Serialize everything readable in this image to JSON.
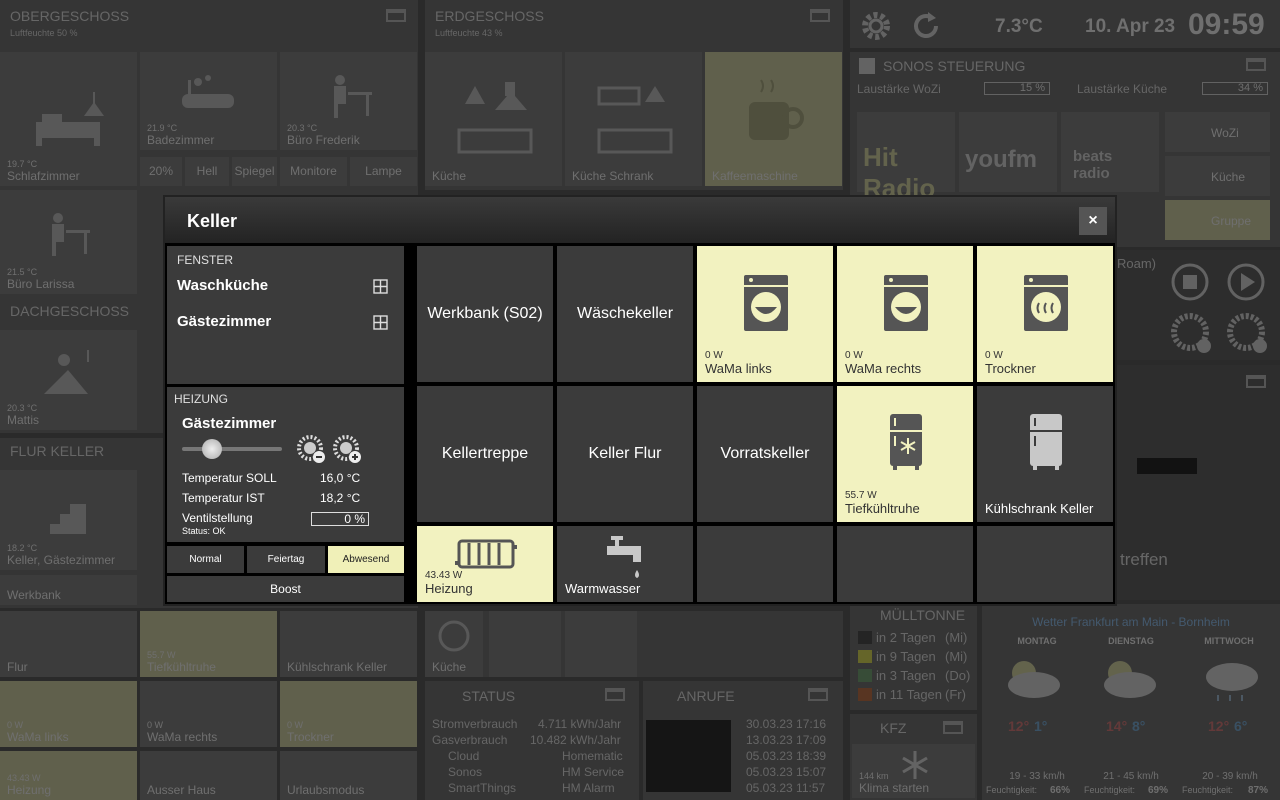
{
  "background": {
    "obergeschoss": {
      "title": "OBERGESCHOSS",
      "sub": "Luftfeuchte 50 %",
      "tiles": [
        {
          "val": "19.7 °C",
          "label": "Schlafzimmer"
        },
        {
          "val": "21.9 °C",
          "label": "Badezimmer"
        },
        {
          "val": "20.3 °C",
          "label": "Büro Frederik"
        },
        {
          "val": "21.5 °C",
          "label": "Büro Larissa"
        }
      ],
      "buttons": [
        "20%",
        "Hell",
        "Spiegel",
        "Monitore",
        "Lampe"
      ]
    },
    "erdgeschoss": {
      "title": "ERDGESCHOSS",
      "sub": "Luftfeuchte 43 %",
      "tiles": [
        {
          "label": "Küche"
        },
        {
          "label": "Küche Schrank"
        },
        {
          "label": "Kaffeemaschine"
        }
      ]
    },
    "top": {
      "temp": "7.3°C",
      "date": "10. Apr 23",
      "time": "09:59"
    },
    "sonos": {
      "title": "SONOS STEUERUNG",
      "vol_wozi_label": "Laustärke WoZi",
      "vol_wozi": "15 %",
      "vol_kueche_label": "Laustärke Küche",
      "vol_kueche": "34 %",
      "stations": [
        "Hit Radio FFH",
        "youfm",
        "beats radio"
      ],
      "rooms": [
        "WoZi",
        "Küche",
        "Gruppe"
      ],
      "roam": "Roam)"
    },
    "dachgeschoss": {
      "title": "DACHGESCHOSS",
      "tile_val": "20.3 °C",
      "tile_label": "Mattis"
    },
    "flurkeller": {
      "title": "FLUR KELLER",
      "tile_val": "18.2 °C",
      "tile_label": "Keller, Gästezimmer",
      "werkbank": "Werkbank"
    },
    "bottom_tiles": [
      {
        "label": "Flur",
        "val": ""
      },
      {
        "label": "Tiefkühltruhe",
        "val": "55.7 W"
      },
      {
        "label": "Kühlschrank Keller",
        "val": ""
      },
      {
        "label": "WaMa links",
        "val": "0 W"
      },
      {
        "label": "WaMa rechts",
        "val": "0 W"
      },
      {
        "label": "Trockner",
        "val": "0 W"
      },
      {
        "label": "Heizung",
        "val": "43.43 W"
      },
      {
        "label": "Ausser Haus",
        "val": ""
      },
      {
        "label": "Urlaubsmodus",
        "val": ""
      }
    ],
    "kueche_small": "Küche",
    "status": {
      "title": "STATUS",
      "strom_label": "Stromverbrauch",
      "strom": "4.711 kWh/Jahr",
      "gas_label": "Gasverbrauch",
      "gas": "10.482 kWh/Jahr",
      "items_left": [
        "Cloud",
        "Sonos",
        "SmartThings"
      ],
      "items_right": [
        "Homematic",
        "HM Service",
        "HM Alarm"
      ]
    },
    "anrufe": {
      "title": "ANRUFE",
      "dates": [
        "30.03.23 17:16",
        "13.03.23 17:09",
        "05.03.23 18:39",
        "05.03.23 15:07",
        "05.03.23 11:57"
      ]
    },
    "muell": {
      "title": "MÜLLTONNE",
      "items": [
        "in 2 Tagen",
        "in 9 Tagen",
        "in 3 Tagen",
        "in 11 Tagen"
      ],
      "days": [
        "(Mi)",
        "(Mi)",
        "(Do)",
        "(Fr)"
      ],
      "colors": [
        "#333333",
        "#8c8c3a",
        "#4d6a4d",
        "#7a4a30"
      ]
    },
    "kfz": {
      "title": "KFZ",
      "km": "144 km",
      "label": "Klima starten"
    },
    "wetter": {
      "title": "Wetter Frankfurt am Main - Bornheim",
      "days": [
        {
          "day": "MONTAG",
          "hi": "12°",
          "lo": "1°",
          "wind": "19 - 33 km/h",
          "hum_label": "Feuchtigkeit:",
          "hum": "66%"
        },
        {
          "day": "DIENSTAG",
          "hi": "14°",
          "lo": "8°",
          "wind": "21 - 45 km/h",
          "hum_label": "Feuchtigkeit:",
          "hum": "69%"
        },
        {
          "day": "MITTWOCH",
          "hi": "12°",
          "lo": "6°",
          "wind": "20 - 39 km/h",
          "hum_label": "Feuchtigkeit:",
          "hum": "87%"
        }
      ]
    },
    "right_partial": {
      "treffen": "treffen"
    }
  },
  "modal": {
    "title": "Keller",
    "close": "×",
    "fenster": {
      "header": "FENSTER",
      "items": [
        "Waschküche",
        "Gästezimmer"
      ]
    },
    "heizung": {
      "header": "HEIZUNG",
      "room": "Gästezimmer",
      "soll_label": "Temperatur SOLL",
      "soll": "16,0 °C",
      "ist_label": "Temperatur IST",
      "ist": "18,2 °C",
      "ventil_label": "Ventilstellung",
      "ventil": "0 %",
      "status": "Status: OK",
      "slider_value": 0.3
    },
    "modes": [
      "Normal",
      "Feiertag",
      "Abwesend"
    ],
    "active_mode": "Abwesend",
    "boost": "Boost",
    "tiles": [
      {
        "label": "Werkbank (S02)"
      },
      {
        "label": "Wäschekeller"
      },
      {
        "label": "WaMa links",
        "val": "0 W"
      },
      {
        "label": "WaMa rechts",
        "val": "0 W"
      },
      {
        "label": "Trockner",
        "val": "0 W"
      },
      {
        "label": "Kellertreppe"
      },
      {
        "label": "Keller Flur"
      },
      {
        "label": "Vorratskeller"
      },
      {
        "label": "Tiefkühltruhe",
        "val": "55.7 W"
      },
      {
        "label": "Kühlschrank Keller"
      },
      {
        "label": "Heizung",
        "val": "43.43 W"
      },
      {
        "label": "Warmwasser"
      }
    ]
  }
}
